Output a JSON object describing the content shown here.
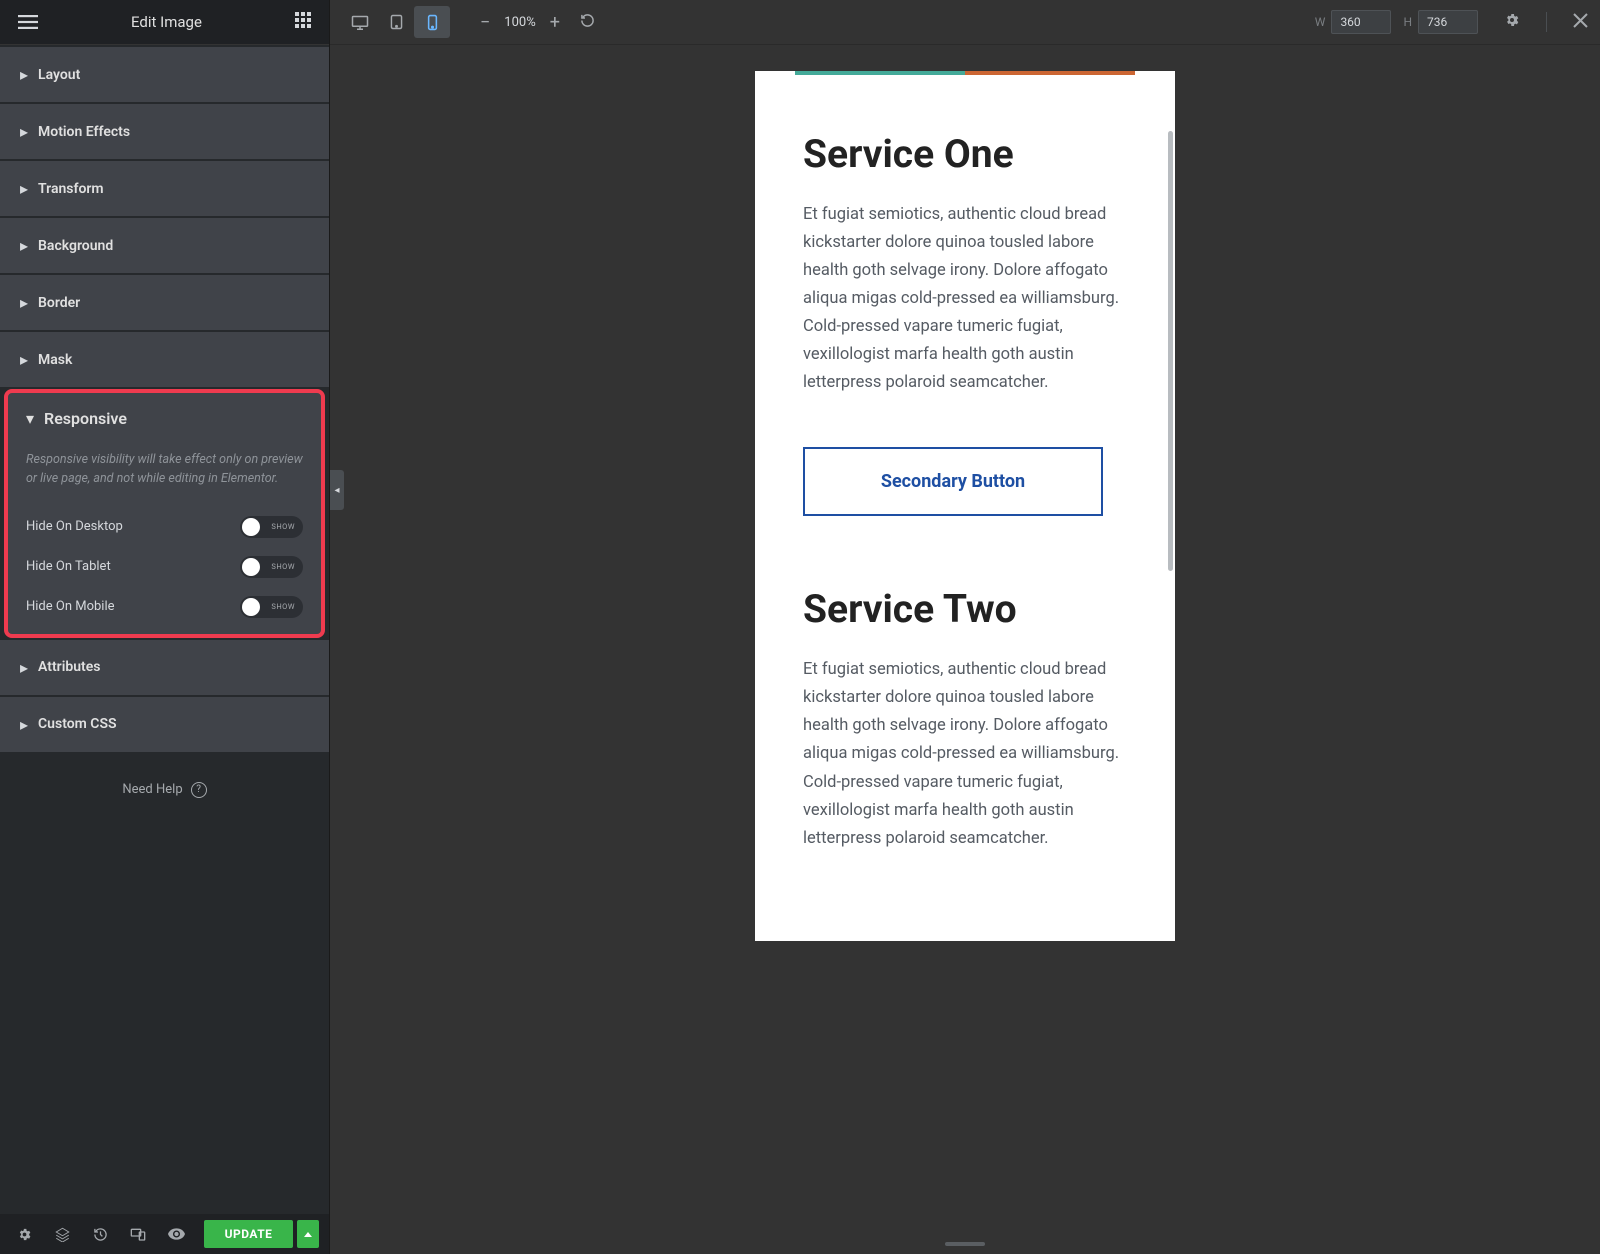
{
  "header": {
    "title": "Edit Image"
  },
  "panels": {
    "items": [
      {
        "label": "Layout"
      },
      {
        "label": "Motion Effects"
      },
      {
        "label": "Transform"
      },
      {
        "label": "Background"
      },
      {
        "label": "Border"
      },
      {
        "label": "Mask"
      }
    ],
    "responsive": {
      "label": "Responsive",
      "desc": "Responsive visibility will take effect only on preview or live page, and not while editing in Elementor.",
      "toggles": [
        {
          "label": "Hide On Desktop",
          "state": "SHOW"
        },
        {
          "label": "Hide On Tablet",
          "state": "SHOW"
        },
        {
          "label": "Hide On Mobile",
          "state": "SHOW"
        }
      ]
    },
    "after": [
      {
        "label": "Attributes"
      },
      {
        "label": "Custom CSS"
      }
    ]
  },
  "help": {
    "label": "Need Help"
  },
  "bottom": {
    "update": "UPDATE"
  },
  "toolbar": {
    "zoom": "100%",
    "width_label": "W",
    "width": "360",
    "height_label": "H",
    "height": "736"
  },
  "preview": {
    "s1_title": "Service One",
    "s1_text": "Et fugiat semiotics, authentic cloud bread kickstarter dolore quinoa tousled labore health goth selvage irony. Dolore affogato aliqua migas cold-pressed ea williamsburg. Cold-pressed vapare tumeric fugiat, vexillologist marfa health goth austin letterpress polaroid seamcatcher.",
    "btn": "Secondary Button",
    "s2_title": "Service Two",
    "s2_text": "Et fugiat semiotics, authentic cloud bread kickstarter dolore quinoa tousled labore health goth selvage irony. Dolore affogato aliqua migas cold-pressed ea williamsburg. Cold-pressed vapare tumeric fugiat, vexillologist marfa health goth austin letterpress polaroid seamcatcher."
  }
}
